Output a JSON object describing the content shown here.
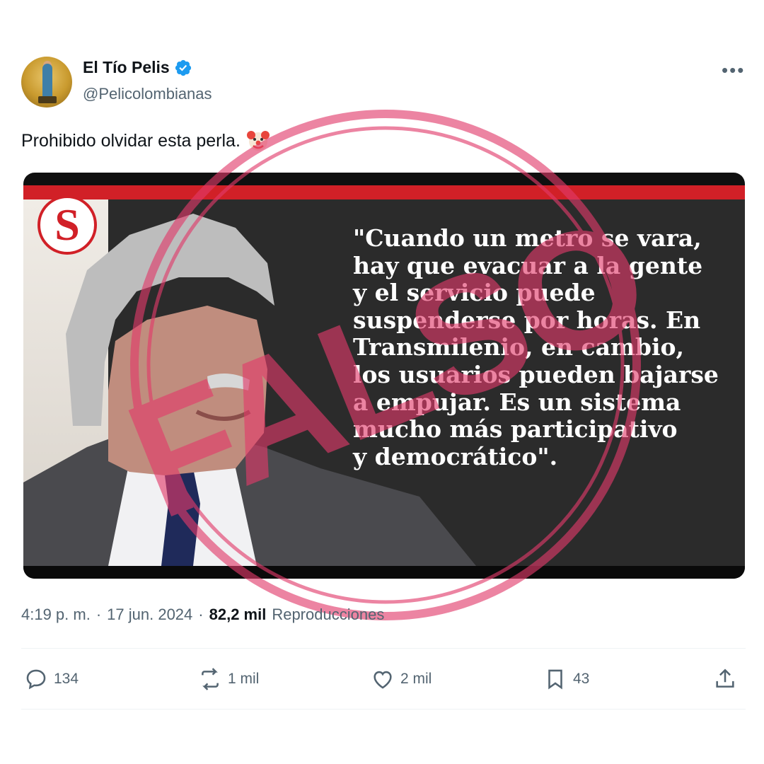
{
  "author": {
    "name": "El Tío Pelis",
    "handle": "@Pelicolombianas",
    "verified": true
  },
  "more_icon": "more-horizontal-icon",
  "tweet_text": "Prohibido olvidar esta perla.",
  "emoji": "clown-face",
  "media": {
    "logo_letter": "S",
    "quote_lines": [
      "\"Cuando un metro se vara,",
      "hay que evacuar a la gente",
      "y el servicio puede",
      "suspenderse por horas. En",
      "Transmilenio, en cambio,",
      "los usuarios pueden bajarse",
      "a empujar. Es un sistema",
      "mucho más participativo",
      "y democrático\"."
    ],
    "accent_color": "#d12027"
  },
  "stamp": {
    "text": "FALSO",
    "color": "#e23a6a"
  },
  "meta": {
    "time": "4:19 p. m.",
    "separator": "·",
    "date": "17 jun. 2024",
    "views_count": "82,2 mil",
    "views_label": "Reproducciones"
  },
  "actions": {
    "replies": "134",
    "reposts": "1 mil",
    "likes": "2 mil",
    "bookmarks": "43"
  }
}
